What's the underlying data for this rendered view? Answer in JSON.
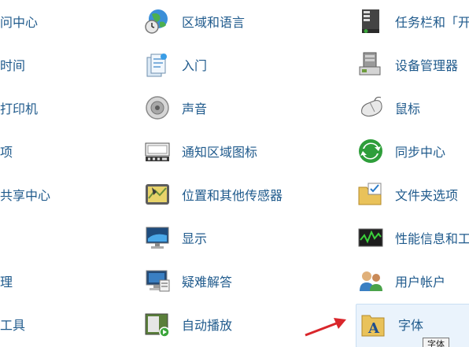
{
  "column1": [
    {
      "label": "访问中心"
    },
    {
      "label": "和时间"
    },
    {
      "label": "和打印机"
    },
    {
      "label": "选项"
    },
    {
      "label": "和共享中心"
    },
    {
      "label": ""
    },
    {
      "label": "管理"
    },
    {
      "label": "小工具"
    }
  ],
  "column2": [
    {
      "label": "区域和语言",
      "icon": "globe-clock-icon"
    },
    {
      "label": "入门",
      "icon": "getting-started-icon"
    },
    {
      "label": "声音",
      "icon": "speaker-icon"
    },
    {
      "label": "通知区域图标",
      "icon": "notification-tray-icon"
    },
    {
      "label": "位置和其他传感器",
      "icon": "location-sensor-icon"
    },
    {
      "label": "显示",
      "icon": "display-icon"
    },
    {
      "label": "疑难解答",
      "icon": "troubleshooting-icon"
    },
    {
      "label": "自动播放",
      "icon": "autoplay-icon"
    }
  ],
  "column3": [
    {
      "label": "任务栏和「开",
      "icon": "taskbar-icon"
    },
    {
      "label": "设备管理器",
      "icon": "device-manager-icon"
    },
    {
      "label": "鼠标",
      "icon": "mouse-icon"
    },
    {
      "label": "同步中心",
      "icon": "sync-center-icon"
    },
    {
      "label": "文件夹选项",
      "icon": "folder-options-icon"
    },
    {
      "label": "性能信息和工",
      "icon": "performance-icon"
    },
    {
      "label": "用户帐户",
      "icon": "user-accounts-icon"
    },
    {
      "label": "字体",
      "icon": "fonts-folder-icon"
    }
  ],
  "tooltip": "字体",
  "colors": {
    "link": "#1f5a8c",
    "highlight_bg": "#eaf3fc",
    "arrow": "#d9262b"
  }
}
